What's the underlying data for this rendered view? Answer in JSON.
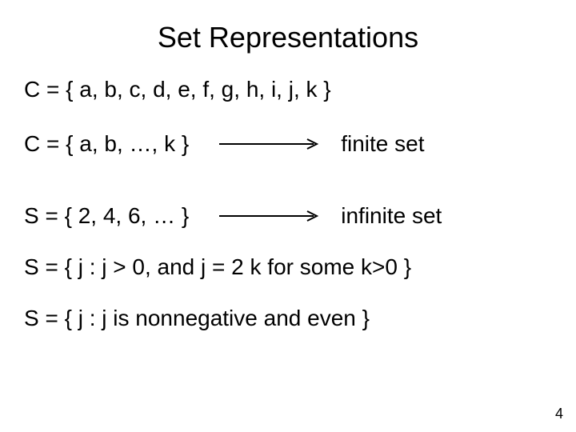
{
  "title": "Set Representations",
  "lines": {
    "l1": "C = { a, b, c, d, e, f, g, h, i, j, k }",
    "l2_lhs": "C = { a, b, …, k }",
    "l2_rhs": "finite set",
    "l3_lhs": "S = { 2, 4, 6, … }",
    "l3_rhs": "infinite set",
    "l4": "S = { j : j > 0, and j = 2 k for some k>0 }",
    "l5": "S = { j : j is nonnegative and even }"
  },
  "page_number": "4"
}
